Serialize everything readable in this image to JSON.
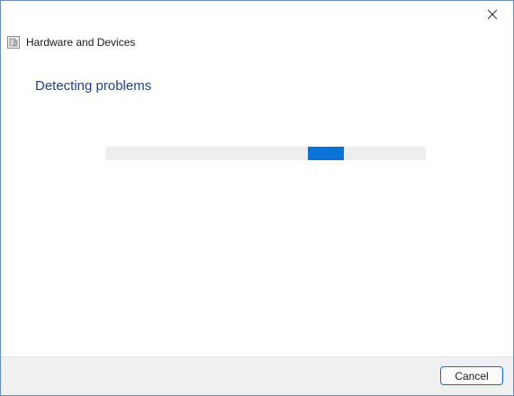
{
  "window": {
    "title": "Hardware and Devices",
    "close_icon": "close-icon",
    "app_icon": "troubleshooter-icon"
  },
  "main": {
    "heading": "Detecting problems",
    "progress": {
      "mode": "indeterminate",
      "chunk_color": "#0a74d6",
      "track_color": "#eeeeee"
    }
  },
  "footer": {
    "cancel_label": "Cancel"
  },
  "colors": {
    "heading": "#1f3f8f",
    "accent": "#0f6ccf",
    "footer_bg": "#f0f0f0"
  }
}
